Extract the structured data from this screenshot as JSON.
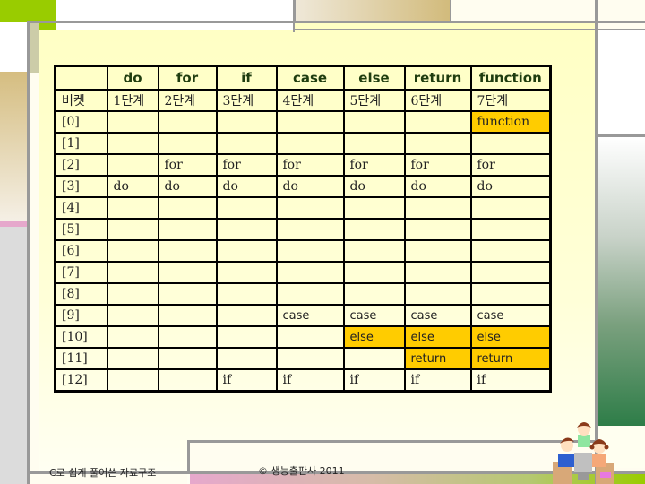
{
  "table": {
    "header_keywords": [
      "",
      "do",
      "for",
      "if",
      "case",
      "else",
      "return",
      "function"
    ],
    "header_stages": [
      "버켓",
      "1단계",
      "2단계",
      "3단계",
      "4단계",
      "5단계",
      "6단계",
      "7단계"
    ],
    "rows": [
      {
        "bucket": "[0]",
        "cells": [
          "",
          "",
          "",
          "",
          "",
          "",
          "function"
        ]
      },
      {
        "bucket": "[1]",
        "cells": [
          "",
          "",
          "",
          "",
          "",
          "",
          ""
        ]
      },
      {
        "bucket": "[2]",
        "cells": [
          "",
          "for",
          "for",
          "for",
          "for",
          "for",
          "for"
        ]
      },
      {
        "bucket": "[3]",
        "cells": [
          "do",
          "do",
          "do",
          "do",
          "do",
          "do",
          "do"
        ]
      },
      {
        "bucket": "[4]",
        "cells": [
          "",
          "",
          "",
          "",
          "",
          "",
          ""
        ]
      },
      {
        "bucket": "[5]",
        "cells": [
          "",
          "",
          "",
          "",
          "",
          "",
          ""
        ]
      },
      {
        "bucket": "[6]",
        "cells": [
          "",
          "",
          "",
          "",
          "",
          "",
          ""
        ]
      },
      {
        "bucket": "[7]",
        "cells": [
          "",
          "",
          "",
          "",
          "",
          "",
          ""
        ]
      },
      {
        "bucket": "[8]",
        "cells": [
          "",
          "",
          "",
          "",
          "",
          "",
          ""
        ]
      },
      {
        "bucket": "[9]",
        "cells": [
          "",
          "",
          "",
          "case",
          "case",
          "case",
          "case"
        ]
      },
      {
        "bucket": "[10]",
        "cells": [
          "",
          "",
          "",
          "",
          "else",
          "else",
          "else"
        ]
      },
      {
        "bucket": "[11]",
        "cells": [
          "",
          "",
          "",
          "",
          "",
          "return",
          "return"
        ]
      },
      {
        "bucket": "[12]",
        "cells": [
          "",
          "",
          "if",
          "if",
          "if",
          "if",
          "if"
        ]
      }
    ],
    "highlight_color": "#ffcc00"
  },
  "footer": {
    "book_title": "C로 쉽게 풀어쓴 자료구조",
    "copyright": "© 생능출판사 2011"
  },
  "decor": {
    "illustration": "children-at-computer"
  }
}
